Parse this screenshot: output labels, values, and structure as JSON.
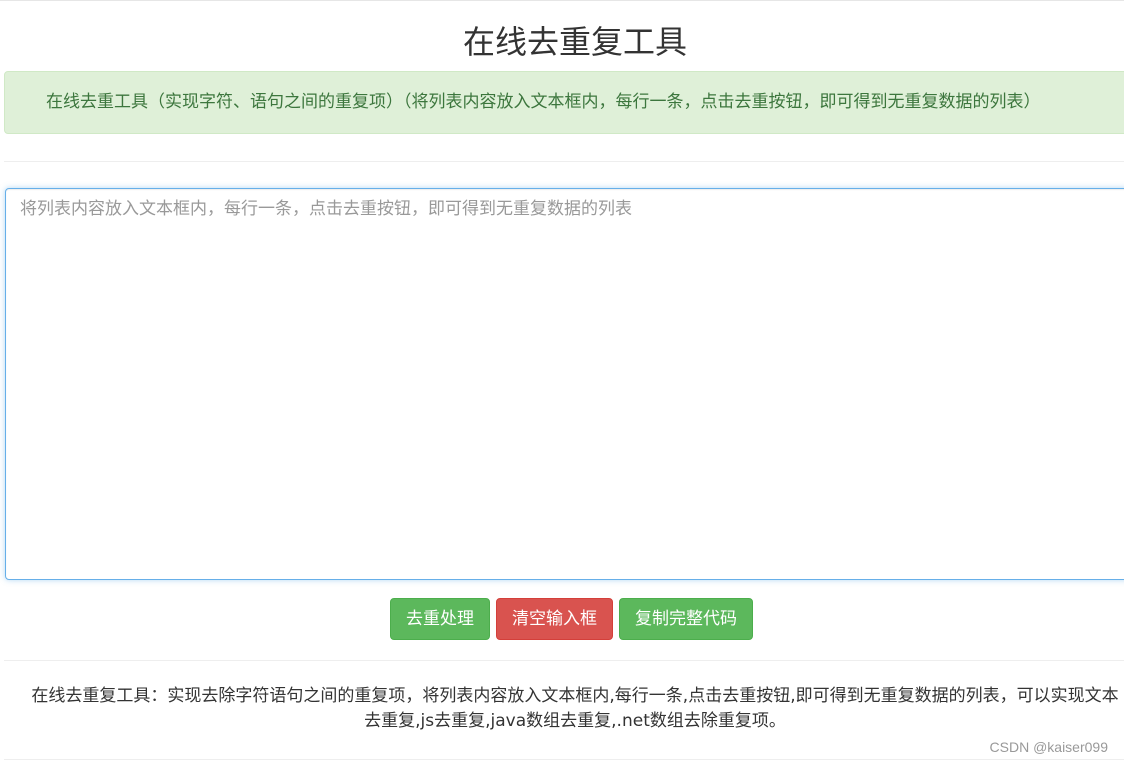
{
  "header": {
    "title": "在线去重复工具"
  },
  "alert": {
    "text": "在线去重工具（实现字符、语句之间的重复项）（将列表内容放入文本框内，每行一条，点击去重按钮，即可得到无重复数据的列表）"
  },
  "editor": {
    "value": "",
    "placeholder": "将列表内容放入文本框内，每行一条，点击去重按钮，即可得到无重复数据的列表"
  },
  "toolbar": {
    "dedupe_label": "去重处理",
    "clear_label": "清空输入框",
    "copy_label": "复制完整代码"
  },
  "footer": {
    "description_line1": "在线去重复工具：实现去除字符语句之间的重复项，将列表内容放入文本框内,每行一条,点击去重按钮,即可得到无重复数据的列表，可以实现文本",
    "description_line2": "去重复,js去重复,java数组去重复,.net数组去除重复项。",
    "watermark": "CSDN @kaiser099"
  },
  "colors": {
    "success": "#5cb85c",
    "danger": "#d9534f",
    "alert_bg": "#dff0d8",
    "alert_text": "#3c763d",
    "focus_border": "#66afe9"
  }
}
